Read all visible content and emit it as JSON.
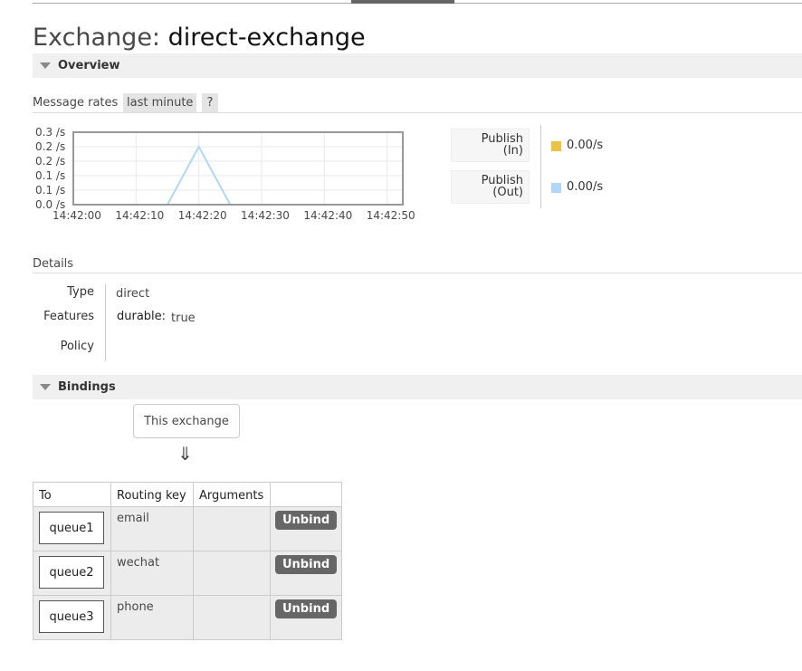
{
  "title": {
    "prefix": "Exchange:",
    "name": "direct-exchange"
  },
  "overview": {
    "heading": "Overview"
  },
  "rates": {
    "label": "Message rates",
    "range": "last minute",
    "help": "?"
  },
  "chart_data": {
    "type": "line",
    "x": [
      "14:42:00",
      "14:42:05",
      "14:42:10",
      "14:42:15",
      "14:42:20",
      "14:42:25",
      "14:42:30",
      "14:42:35",
      "14:42:40",
      "14:42:45",
      "14:42:50",
      "14:42:55"
    ],
    "series": [
      {
        "name": "Publish (In)",
        "color": "#edc240",
        "values": [
          0,
          0,
          0,
          0,
          0,
          0,
          0,
          0,
          0,
          0,
          0,
          0
        ]
      },
      {
        "name": "Publish (Out)",
        "color": "#afd8f8",
        "values": [
          0,
          0,
          0,
          0,
          0.2,
          0,
          0,
          0,
          0,
          0,
          0,
          0
        ]
      }
    ],
    "yticks": [
      "0.0 /s",
      "0.1 /s",
      "0.1 /s",
      "0.2 /s",
      "0.2 /s",
      "0.3 /s"
    ],
    "xticks": [
      "14:42:00",
      "14:42:10",
      "14:42:20",
      "14:42:30",
      "14:42:40",
      "14:42:50"
    ],
    "ylim": [
      0,
      0.25
    ],
    "grid": true
  },
  "legend": [
    {
      "label_line1": "Publish",
      "label_line2": "(In)",
      "color": "#edc240",
      "value": "0.00/s"
    },
    {
      "label_line1": "Publish",
      "label_line2": "(Out)",
      "color": "#afd8f8",
      "value": "0.00/s"
    }
  ],
  "details": {
    "heading": "Details",
    "type_key": "Type",
    "type_value": "direct",
    "features_key": "Features",
    "durable_key": "durable:",
    "durable_value": "true",
    "policy_key": "Policy"
  },
  "bindings": {
    "heading": "Bindings",
    "this_exchange": "This exchange",
    "arrow": "⇓",
    "columns": [
      "To",
      "Routing key",
      "Arguments",
      ""
    ],
    "rows": [
      {
        "to": "queue1",
        "routing_key": "email",
        "arguments": "",
        "action": "Unbind"
      },
      {
        "to": "queue2",
        "routing_key": "wechat",
        "arguments": "",
        "action": "Unbind"
      },
      {
        "to": "queue3",
        "routing_key": "phone",
        "arguments": "",
        "action": "Unbind"
      }
    ]
  }
}
